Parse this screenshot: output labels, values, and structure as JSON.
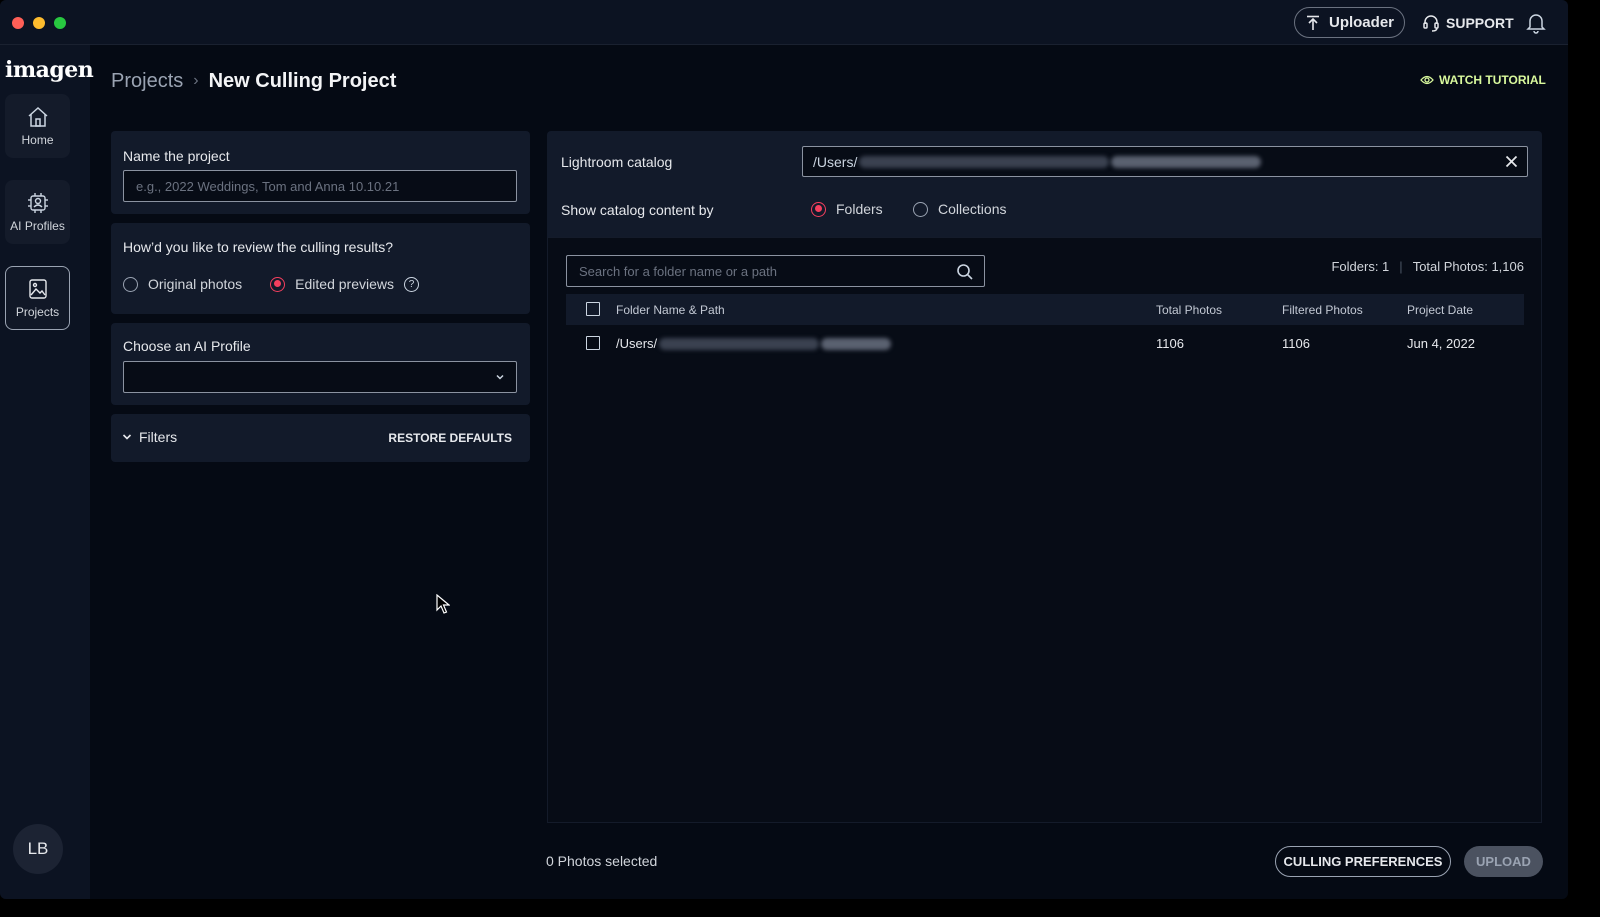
{
  "titlebar": {
    "uploader_label": "Uploader",
    "support_label": "SUPPORT"
  },
  "sidebar": {
    "logo": "imagen",
    "items": [
      {
        "label": "Home",
        "icon": "home-icon"
      },
      {
        "label": "AI Profiles",
        "icon": "ai-profile-icon"
      },
      {
        "label": "Projects",
        "icon": "projects-icon",
        "active": true
      }
    ],
    "avatar_initials": "LB"
  },
  "header": {
    "breadcrumb_root": "Projects",
    "breadcrumb_sep": "›",
    "title": "New Culling Project",
    "watch_tutorial": "WATCH TUTORIAL"
  },
  "project_form": {
    "name_label": "Name the project",
    "name_placeholder": "e.g., 2022 Weddings, Tom and Anna 10.10.21",
    "review_label": "How’d you like to review the culling results?",
    "review_options": [
      "Original photos",
      "Edited previews"
    ],
    "review_selected": "Edited previews",
    "help_glyph": "?",
    "ai_profile_label": "Choose an AI Profile",
    "ai_profile_value": "",
    "filters_label": "Filters",
    "restore_defaults": "RESTORE DEFAULTS"
  },
  "catalog": {
    "label": "Lightroom catalog",
    "path_prefix": "/Users/",
    "show_by_label": "Show catalog content by",
    "options": [
      "Folders",
      "Collections"
    ],
    "selected": "Folders"
  },
  "folders_table": {
    "search_placeholder": "Search for a folder name or a path",
    "folders_count": "Folders: 1",
    "total_photos": "Total Photos: 1,106",
    "columns": [
      "Folder Name & Path",
      "Total Photos",
      "Filtered Photos",
      "Project Date"
    ],
    "rows": [
      {
        "path_prefix": "/Users/",
        "total": "1106",
        "filtered": "1106",
        "date": "Jun 4, 2022"
      }
    ]
  },
  "footer": {
    "selected_text": "0 Photos selected",
    "culling_preferences": "CULLING PREFERENCES",
    "upload": "UPLOAD"
  },
  "colors": {
    "accent": "#f43f5e",
    "tutorial": "#d9f99d",
    "background": "#050a14",
    "panel": "#121a2a"
  }
}
